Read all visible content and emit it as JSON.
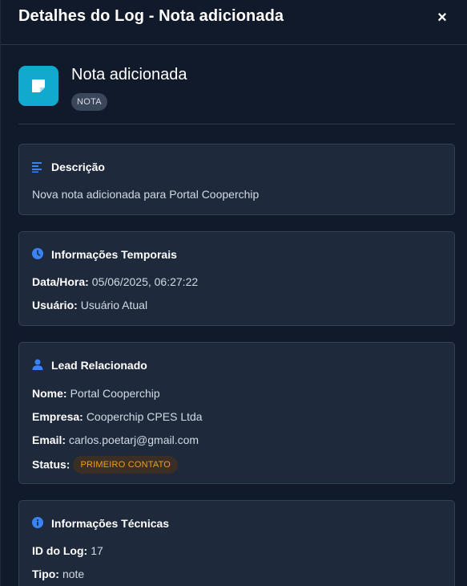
{
  "header": {
    "title": "Detalhes do Log - Nota adicionada",
    "close_label": "×"
  },
  "summary": {
    "name": "Nota adicionada",
    "tag": "NOTA",
    "icon": "note-icon",
    "icon_color": "#12a9cf"
  },
  "descricao": {
    "title": "Descrição",
    "icon": "align-left-icon",
    "text": "Nova nota adicionada para Portal Cooperchip"
  },
  "temporal": {
    "title": "Informações Temporais",
    "icon": "clock-icon",
    "datetime_label": "Data/Hora:",
    "datetime_value": "05/06/2025, 06:27:22",
    "user_label": "Usuário:",
    "user_value": "Usuário Atual"
  },
  "lead": {
    "title": "Lead Relacionado",
    "icon": "user-icon",
    "name_label": "Nome:",
    "name_value": "Portal Cooperchip",
    "company_label": "Empresa:",
    "company_value": "Cooperchip CPES Ltda",
    "email_label": "Email:",
    "email_value": "carlos.poetarj@gmail.com",
    "status_label": "Status:",
    "status_value": "PRIMEIRO CONTATO",
    "status_color": "#f59e0b"
  },
  "tecnicas": {
    "title": "Informações Técnicas",
    "icon": "info-icon",
    "id_label": "ID do Log:",
    "id_value": "17",
    "type_label": "Tipo:",
    "type_value": "note"
  },
  "colors": {
    "background": "#111a2b",
    "card": "#1e293b",
    "accent_blue": "#3b82f6"
  }
}
